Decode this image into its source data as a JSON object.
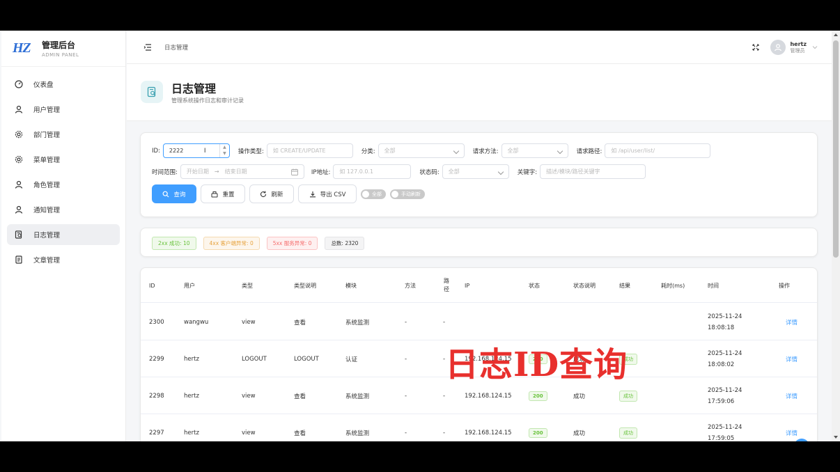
{
  "brand": {
    "title": "管理后台",
    "subtitle": "ADMIN PANEL",
    "logo_text": "HZ"
  },
  "sidebar": {
    "items": [
      {
        "label": "仪表盘",
        "icon": "dashboard-icon",
        "active": false
      },
      {
        "label": "用户管理",
        "icon": "user-icon",
        "active": false
      },
      {
        "label": "部门管理",
        "icon": "gear-icon",
        "active": false
      },
      {
        "label": "菜单管理",
        "icon": "gear-icon",
        "active": false
      },
      {
        "label": "角色管理",
        "icon": "user-icon",
        "active": false
      },
      {
        "label": "通知管理",
        "icon": "user-icon",
        "active": false
      },
      {
        "label": "日志管理",
        "icon": "log-icon",
        "active": true
      },
      {
        "label": "文章管理",
        "icon": "document-icon",
        "active": false
      }
    ]
  },
  "header": {
    "breadcrumb": "日志管理",
    "user": {
      "name": "hertz",
      "role": "管理员"
    }
  },
  "page": {
    "title": "日志管理",
    "description": "管理系统操作日志和审计记录"
  },
  "filters": {
    "id": {
      "label": "ID:",
      "value": "2222"
    },
    "op_type": {
      "label": "操作类型:",
      "placeholder": "如 CREATE/UPDATE"
    },
    "category": {
      "label": "分类:",
      "value": "全部"
    },
    "method": {
      "label": "请求方法:",
      "value": "全部"
    },
    "path": {
      "label": "请求路径:",
      "placeholder": "如 /api/user/list/"
    },
    "time_range": {
      "label": "时间范围:",
      "start_placeholder": "开始日期",
      "end_placeholder": "结束日期",
      "separator": "→"
    },
    "ip": {
      "label": "IP地址:",
      "placeholder": "如 127.0.0.1"
    },
    "status": {
      "label": "状态码:",
      "value": "全部"
    },
    "keyword": {
      "label": "关键字:",
      "placeholder": "描述/模块/路径关键字"
    }
  },
  "actions": {
    "query": "查询",
    "reset": "重置",
    "refresh": "刷新",
    "export": "导出 CSV",
    "toggle_all": "全部",
    "toggle_manual": "手动刷新"
  },
  "stats": {
    "success": "2xx 成功: 10",
    "client_error": "4xx 客户端异常: 0",
    "server_error": "5xx 服务异常: 0",
    "total": "总数: 2320"
  },
  "table": {
    "columns": [
      "ID",
      "用户",
      "类型",
      "类型说明",
      "模块",
      "方法",
      "路径",
      "IP",
      "状态",
      "状态说明",
      "结果",
      "耗时(ms)",
      "时间",
      "操作"
    ],
    "rows": [
      {
        "id": "2300",
        "user": "wangwu",
        "type": "view",
        "type_desc": "查看",
        "module": "系统监测",
        "method": "-",
        "path": "-",
        "ip": "",
        "status": "",
        "status_desc": "",
        "result": "",
        "duration": "",
        "date": "2025-11-24",
        "time": "18:08:18",
        "action": "详情"
      },
      {
        "id": "2299",
        "user": "hertz",
        "type": "LOGOUT",
        "type_desc": "LOGOUT",
        "module": "认证",
        "method": "-",
        "path": "-",
        "ip": "192.168.124.15",
        "status": "200",
        "status_desc": "成功",
        "result": "成功",
        "duration": "",
        "date": "2025-11-24",
        "time": "18:08:02",
        "action": "详情"
      },
      {
        "id": "2298",
        "user": "hertz",
        "type": "view",
        "type_desc": "查看",
        "module": "系统监测",
        "method": "-",
        "path": "-",
        "ip": "192.168.124.15",
        "status": "200",
        "status_desc": "成功",
        "result": "成功",
        "duration": "",
        "date": "2025-11-24",
        "time": "17:59:06",
        "action": "详情"
      },
      {
        "id": "2297",
        "user": "hertz",
        "type": "view",
        "type_desc": "查看",
        "module": "系统监测",
        "method": "-",
        "path": "-",
        "ip": "192.168.124.15",
        "status": "200",
        "status_desc": "成功",
        "result": "成功",
        "duration": "",
        "date": "2025-11-24",
        "time": "17:59:05",
        "action": "详情"
      }
    ]
  },
  "overlay_caption": "日志ID查询",
  "colors": {
    "primary": "#409eff",
    "success": "#67c23a",
    "warning": "#e6a23c",
    "danger": "#f56c6c",
    "overlay": "#e8302d",
    "brand": "#2f6fd6"
  }
}
